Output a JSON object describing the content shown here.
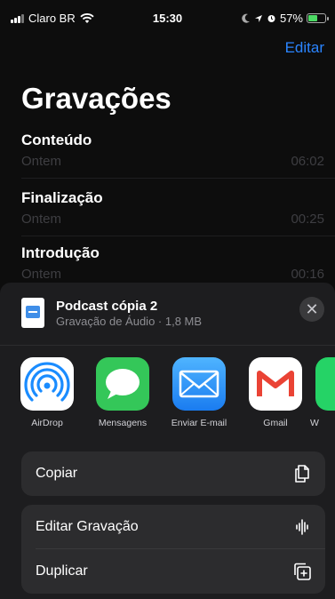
{
  "status": {
    "carrier": "Claro BR",
    "time": "15:30",
    "battery": "57%",
    "battery_level": 0.57
  },
  "nav": {
    "edit_label": "Editar"
  },
  "page": {
    "title": "Gravações"
  },
  "recordings": [
    {
      "name": "Conteúdo",
      "date": "Ontem",
      "duration": "06:02"
    },
    {
      "name": "Finalização",
      "date": "Ontem",
      "duration": "00:25"
    },
    {
      "name": "Introdução",
      "date": "Ontem",
      "duration": "00:16"
    }
  ],
  "share": {
    "file_title": "Podcast cópia 2",
    "file_subtitle": "Gravação de Áudio · 1,8 MB",
    "close_symbol": "✕",
    "apps": [
      {
        "label": "AirDrop",
        "icon": "airdrop-icon"
      },
      {
        "label": "Mensagens",
        "icon": "messages-icon"
      },
      {
        "label": "Enviar E-mail",
        "icon": "mail-icon"
      },
      {
        "label": "Gmail",
        "icon": "gmail-icon"
      },
      {
        "label": "W",
        "icon": "whatsapp-icon"
      }
    ],
    "actions": [
      {
        "label": "Copiar",
        "icon": "copy-icon"
      },
      {
        "label": "Editar Gravação",
        "icon": "waveform-icon"
      },
      {
        "label": "Duplicar",
        "icon": "duplicate-icon"
      }
    ]
  },
  "colors": {
    "accent": "#2a84ff",
    "messages_green": "#34c759",
    "mail_blue": "#1a8cff",
    "gmail_red": "#ea4335"
  }
}
